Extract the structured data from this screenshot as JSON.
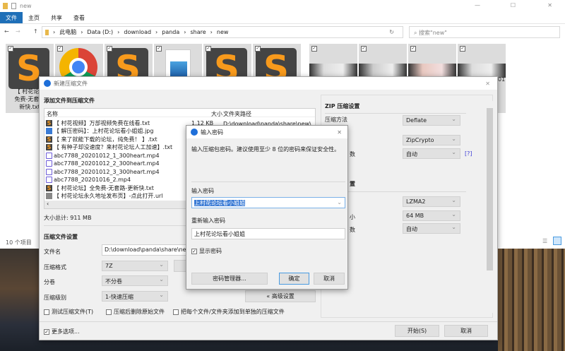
{
  "explorer": {
    "title": "new",
    "tabs": [
      "文件",
      "主页",
      "共享",
      "查看"
    ],
    "path": [
      "此电脑",
      "Data (D:)",
      "download",
      "panda",
      "share",
      "new"
    ],
    "search_placeholder": "搜索\"new\"",
    "thumb_caption": [
      "【 村花论坛",
      "免费-无套路",
      "新快.txt"
    ],
    "thumb_caption_right": "01",
    "status": "10 个项目"
  },
  "dialog": {
    "title": "新建压缩文件",
    "add_heading": "添加文件到压缩文件",
    "columns": [
      "名称",
      "大小",
      "文件夹路径"
    ],
    "files": [
      {
        "name": "【 村花视频】万部视频免费在线看.txt",
        "icon": "sublime-text",
        "size": "1.12 KB",
        "path": "D:\\download\\panda\\share\\new\\【 村"
      },
      {
        "name": "【 解压密码】：上村花论坛看小姐姐.jpg",
        "icon": "image"
      },
      {
        "name": "【 来了就能下载的论坛，纯免费！ 】.txt",
        "icon": "sublime-text"
      },
      {
        "name": "【 有种子却没速度？来村花论坛人工加速】.txt",
        "icon": "sublime-text"
      },
      {
        "name": "abc7788_20201012_1_300heart.mp4",
        "icon": "video"
      },
      {
        "name": "abc7788_20201012_2_300heart.mp4",
        "icon": "video"
      },
      {
        "name": "abc7788_20201012_3_300heart.mp4",
        "icon": "video"
      },
      {
        "name": "abc7788_20201016_2.mp4",
        "icon": "video"
      },
      {
        "name": "【 村花论坛】全免费-无套路-更新快.txt",
        "icon": "sublime-text"
      },
      {
        "name": "【 村花论坛永久地址发布页】-点此打开.url",
        "icon": "url"
      }
    ],
    "total": "大小总计: 911 MB",
    "settings_heading": "压缩文件设置",
    "filename_label": "文件名",
    "filename_value": "D:\\download\\panda\\share\\new\\",
    "format_label": "压缩格式",
    "format_value": "7Z",
    "volume_label": "分卷",
    "volume_value": "不分卷",
    "level_label": "压缩级别",
    "level_value": "1-快速压缩",
    "advanced_button": "« 高级设置",
    "checks": [
      {
        "label": "测试压缩文件(T)",
        "checked": false
      },
      {
        "label": "压缩后删除原始文件",
        "checked": false
      },
      {
        "label": "把每个文件/文件夹添加到单独的压缩文件",
        "checked": false
      }
    ],
    "more_options": {
      "label": "更多选项...",
      "checked": true
    },
    "start_button": "开始(S)",
    "cancel_button": "取消",
    "zip": {
      "heading": "ZIP 压缩设置",
      "method_label": "压缩方法",
      "method_value": "Deflate",
      "encrypt_value": "ZipCrypto",
      "threads_fragment": "数",
      "threads_value": "自动",
      "help": "[?]"
    },
    "sevenz": {
      "heading_fragment": "置",
      "algo_value": "LZMA2",
      "dict_fragment": "小",
      "dict_value": "64 MB",
      "threads_fragment": "数",
      "threads_value": "自动"
    }
  },
  "password": {
    "title": "输入密码",
    "hint": "输入压缩包密码。建议使用至少 8 位的密码来保证安全性。",
    "enter_label": "输入密码",
    "enter_value": "上村花论坛看小姐姐",
    "reenter_label": "重新输入密码",
    "reenter_value": "上村花论坛看小姐姐",
    "show_label": "显示密码",
    "show_checked": true,
    "manager_button": "密码管理器...",
    "ok_button": "确定",
    "cancel_button": "取消"
  },
  "colors": {
    "accent": "#1e6fb8",
    "selection": "#3a7bd5",
    "help_link": "#3b3bd6"
  }
}
